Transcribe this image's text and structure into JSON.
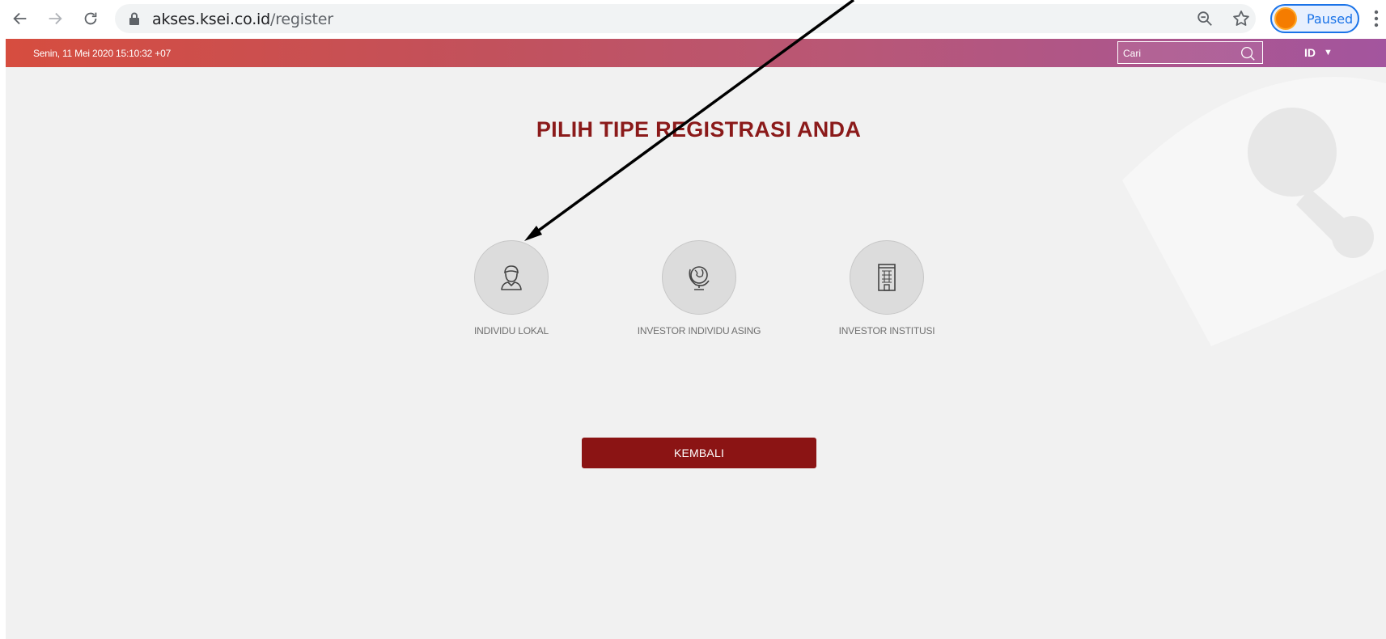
{
  "browser": {
    "url_host": "akses.ksei.co.id",
    "url_path": "/register",
    "profile_status": "Paused"
  },
  "header": {
    "datetime": "Senin, 11 Mei 2020 15:10:32 +07",
    "search_placeholder": "Cari",
    "language": "ID",
    "language_caret": "▼"
  },
  "main": {
    "title": "PILIH TIPE REGISTRASI ANDA",
    "options": [
      {
        "label": "INDIVIDU LOKAL",
        "icon": "person-icon"
      },
      {
        "label": "INVESTOR INDIVIDU ASING",
        "icon": "globe-icon"
      },
      {
        "label": "INVESTOR INSTITUSI",
        "icon": "building-icon"
      }
    ],
    "back_label": "KEMBALI"
  },
  "colors": {
    "title": "#8b1a1a",
    "button": "#8b1414",
    "header_start": "#d64d3f",
    "header_end": "#a3559e",
    "background": "#f1f1f1"
  }
}
